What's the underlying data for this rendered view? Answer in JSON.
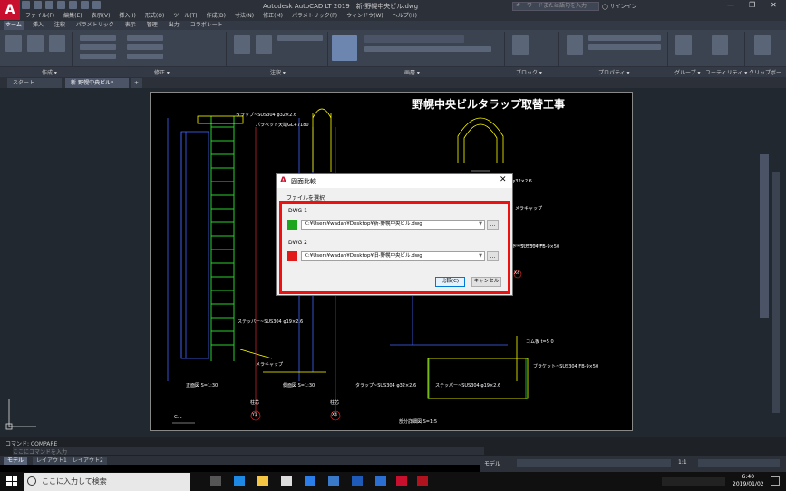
{
  "window": {
    "app_logo": "A",
    "title": "Autodesk AutoCAD LT 2019　新-野幌中央ビル.dwg",
    "search_placeholder": "キーワードまたは語句を入力",
    "sign_in": "サインイン"
  },
  "menu": [
    "ファイル(F)",
    "編集(E)",
    "表示(V)",
    "挿入(I)",
    "形式(O)",
    "ツール(T)",
    "作成(D)",
    "寸法(N)",
    "修正(M)",
    "パラメトリック(P)",
    "ウィンドウ(W)",
    "ヘルプ(H)"
  ],
  "ribbon_tabs": [
    {
      "label": "ホーム",
      "active": true
    },
    {
      "label": "挿入",
      "active": false
    },
    {
      "label": "注釈",
      "active": false
    },
    {
      "label": "パラメトリック",
      "active": false
    },
    {
      "label": "表示",
      "active": false
    },
    {
      "label": "管理",
      "active": false
    },
    {
      "label": "出力",
      "active": false
    },
    {
      "label": "コラボレート",
      "active": false
    }
  ],
  "ribbon_panels": [
    "作成 ▾",
    "修正 ▾",
    "注釈 ▾",
    "画層 ▾",
    "ブロック ▾",
    "プロパティ ▾",
    "グループ ▾",
    "ユーティリティ ▾",
    "クリップボード"
  ],
  "doc_tabs": [
    {
      "label": "スタート",
      "active": false
    },
    {
      "label": "新-野幌中央ビル*",
      "active": true
    }
  ],
  "drawing": {
    "title": "野幌中央ビルタラップ取替工事",
    "labels": {
      "tarap_top": "タラップ~SUS304 φ32×2.6",
      "parapet": "パラペット天端GL+7180",
      "stepper": "ステッパー~SUS304 φ19×2.6",
      "mera_cap": "メラキャップ",
      "mera_cap_2": "メラキャップ",
      "front_view": "正面図 S=1:30",
      "side_view": "側面図 S=1:30",
      "detail": "部分詳細図 S=1:5",
      "tarap_bottom": "タラップ~SUS304 φ32×2.6",
      "stepper_bottom": "ステッパー~SUS304 φ19×2.6",
      "bracket": "ブラケット~SUS304 FB-9×50",
      "bracket_2": "ト~SUS304 FB-9×50",
      "rubber": "ゴム板 t=5 0",
      "pillar": "柱芯",
      "pillar_2": "柱芯",
      "gl": "G.L",
      "y1": "Y1",
      "x4": "X4",
      "x4b": "X4",
      "dim": "φ32×2.6"
    }
  },
  "dialog": {
    "title": "図面比較",
    "section": "ファイルを選択",
    "dwg1_label": "DWG 1",
    "dwg1_path": "C:¥Users¥wadah¥Desktop¥新-野幌中央ビル.dwg",
    "dwg1_color": "#1fa61f",
    "dwg2_label": "DWG 2",
    "dwg2_path": "C:¥Users¥wadah¥Desktop¥旧-野幌中央ビル.dwg",
    "dwg2_color": "#e11a1a",
    "browse": "...",
    "compare_button": "比較(C)",
    "cancel_button": "キャンセル",
    "close": "✕"
  },
  "command": {
    "history": "コマンド: COMPARE",
    "prompt_placeholder": "ここにコマンドを入力"
  },
  "layout_tabs": [
    {
      "label": "モデル",
      "active": true
    },
    {
      "label": "レイアウト1",
      "active": false
    },
    {
      "label": "レイアウト2",
      "active": false
    }
  ],
  "status": {
    "model": "モデル",
    "scale": "1:1"
  },
  "taskbar": {
    "search_placeholder": "ここに入力して検索",
    "time": "6:40",
    "date": "2019/01/02"
  },
  "accent": "#c8102e"
}
